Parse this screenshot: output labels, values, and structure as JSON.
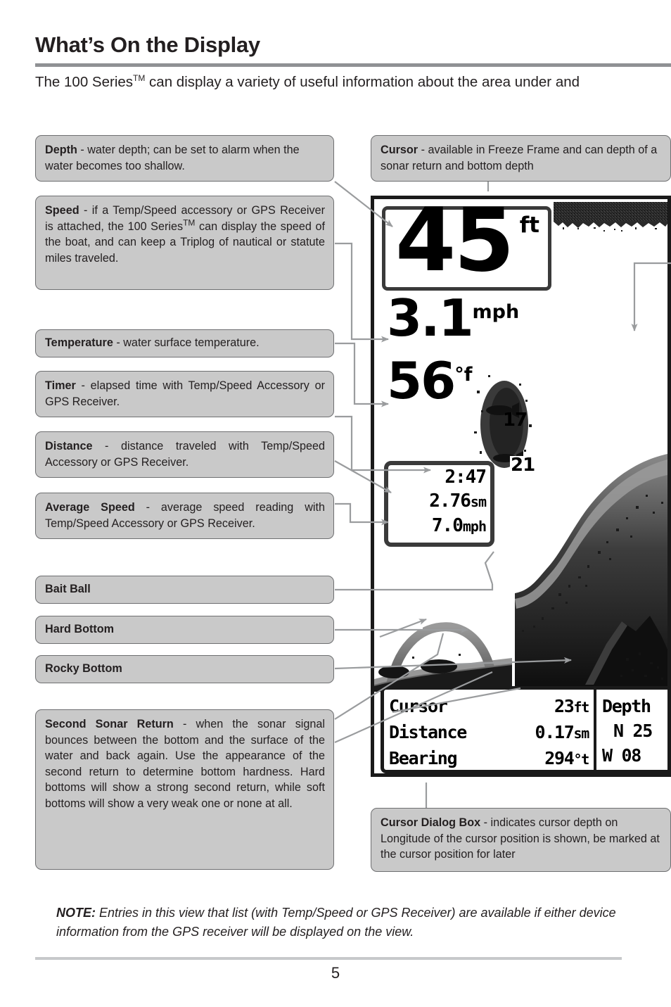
{
  "header": {
    "title": "What’s On the Display",
    "intro_pre": "The 100 Series",
    "intro_tm": "TM",
    "intro_post": " can display a variety of useful information about the area under and"
  },
  "callouts": {
    "depth": {
      "term": "Depth",
      "body": " - water depth; can be set to alarm when the water becomes too shallow."
    },
    "speed": {
      "term": "Speed",
      "body_a": " - if a Temp/Speed accessory or GPS Receiver is attached, the 100 Series",
      "tm": "TM",
      "body_b": " can display the speed of the boat, and can keep a Triplog of nautical or statute miles traveled."
    },
    "temperature": {
      "term": "Temperature",
      "body": " - water surface temperature."
    },
    "timer": {
      "term": "Timer",
      "body": " - elapsed time with Temp/Speed Accessory or GPS Receiver."
    },
    "distance": {
      "term": "Distance",
      "body": " - distance traveled with Temp/Speed Accessory or GPS Receiver."
    },
    "average_speed": {
      "term": "Average Speed",
      "body": " - average speed reading with Temp/Speed Accessory or GPS Receiver."
    },
    "bait_ball": {
      "term": "Bait Ball",
      "body": ""
    },
    "hard_bottom": {
      "term": "Hard Bottom",
      "body": ""
    },
    "rocky_bottom": {
      "term": "Rocky Bottom",
      "body": ""
    },
    "second_sonar_return": {
      "term": "Second Sonar Return",
      "body": " - when the sonar signal bounces between the bottom and the surface of the water and back again. Use the appearance of the second return to determine bottom hardness. Hard bottoms will show a strong second return, while soft bottoms will show a very weak one or none at all."
    },
    "cursor": {
      "term": "Cursor",
      "body": " - available in Freeze Frame and can depth of a sonar return and bottom depth"
    },
    "cursor_dialog_box": {
      "term": "Cursor Dialog Box",
      "body": " - indicates cursor depth on Longitude of the cursor position is shown, be marked at the cursor position for later"
    }
  },
  "sonar": {
    "depth_value": "45",
    "depth_units": "ft",
    "speed_value": "3.1",
    "speed_units": "mph",
    "temp_value": "56",
    "temp_units": "°f",
    "fish_labels": [
      "17",
      "21"
    ],
    "triplog": {
      "timer": "2:47",
      "distance": "2.76",
      "distance_units": "sm",
      "avg_speed": "7.0",
      "avg_speed_units": "mph"
    },
    "cursor_dialog": {
      "rows": [
        {
          "label": "Cursor",
          "value": "23",
          "units": "ft"
        },
        {
          "label": "Distance",
          "value": "0.17",
          "units": "sm"
        },
        {
          "label": "Bearing",
          "value": "294",
          "units": "°t"
        }
      ],
      "right": {
        "title": "Depth",
        "latitude": "N 25",
        "longitude": "W 08"
      }
    }
  },
  "note": {
    "label": "NOTE:",
    "body": " Entries in this view that list (with Temp/Speed or GPS Receiver) are available if either device information from the GPS receiver will be displayed on the view."
  },
  "footer": {
    "page_number": "5"
  },
  "colors": {
    "callout_fill": "#c9c9c9",
    "callout_border": "#6e6f71",
    "rule": "#8f9194",
    "connector": "#9a9c9e",
    "text": "#231f20"
  }
}
